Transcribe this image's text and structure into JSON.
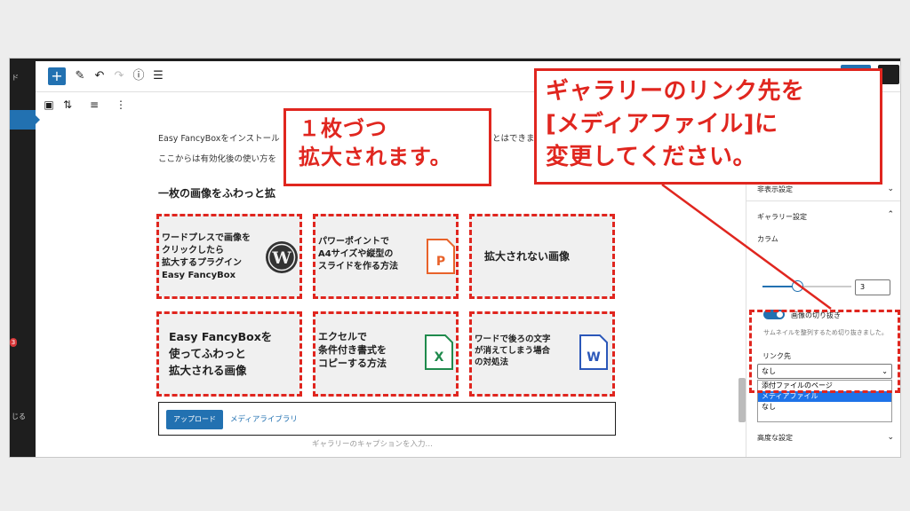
{
  "admin_sidebar": {
    "label_top": "ド",
    "badge": "3",
    "label_bottom": "じる"
  },
  "toolbar": {
    "inserter": "+",
    "edit_icon": "✎",
    "undo_icon": "↶",
    "redo_icon": "↷",
    "info_icon": "ⓘ",
    "list_icon": "☰",
    "block_gallery_icon": "▣",
    "move_icon": "⇅",
    "align_icon": "≡",
    "more_icon": "⋮"
  },
  "content": {
    "para1": "Easy FancyBoxをインストール",
    "para1_tail": "とはできま",
    "para2": "ここからは有効化後の使い方を",
    "heading": "一枚の画像をふわっと拡",
    "tiles": [
      {
        "label": "ワードプレスで画像を\nクリックしたら\n拡大するプラグイン\nEasy FancyBox",
        "icon": "wordpress-logo-icon"
      },
      {
        "label": "パワーポイントで\nA4サイズや縦型の\nスライドを作る方法",
        "icon": "powerpoint-icon",
        "icon_letter": "P"
      },
      {
        "label": "拡大されない画像",
        "icon": ""
      },
      {
        "label": "Easy FancyBoxを\n使ってふわっと\n拡大される画像",
        "icon": ""
      },
      {
        "label": "エクセルで\n条件付き書式を\nコピーする方法",
        "icon": "excel-icon",
        "icon_letter": "X"
      },
      {
        "label": "ワードで後ろの文字\nが消えてしまう場合\nの対処法",
        "icon": "word-icon",
        "icon_letter": "W"
      }
    ],
    "upload_button": "アップロード",
    "media_library": "メディアライブラリ",
    "caption_placeholder": "ギャラリーのキャプションを入力…"
  },
  "panel": {
    "display_settings": "非表示設定",
    "gallery_settings": "ギャラリー設定",
    "columns_label": "カラム",
    "columns_value": "3",
    "crop_label": "画像の切り抜き",
    "crop_help": "サムネイルを整列するため切り抜きました。",
    "link_label": "リンク先",
    "link_value": "なし",
    "link_options": [
      "添付ファイルのページ",
      "メディアファイル",
      "なし"
    ],
    "link_selected": "メディアファイル",
    "advanced": "高度な設定"
  },
  "annotations": {
    "left": "１枚づつ\n拡大されます。",
    "right": "ギャラリーのリンク先を\n[メディアファイル]に\n変更してください。"
  },
  "colors": {
    "accent": "#2271b1",
    "annotation_red": "#e0261f",
    "powerpoint": "#e8622a",
    "excel": "#1f8a4c",
    "word": "#2b57b9"
  }
}
